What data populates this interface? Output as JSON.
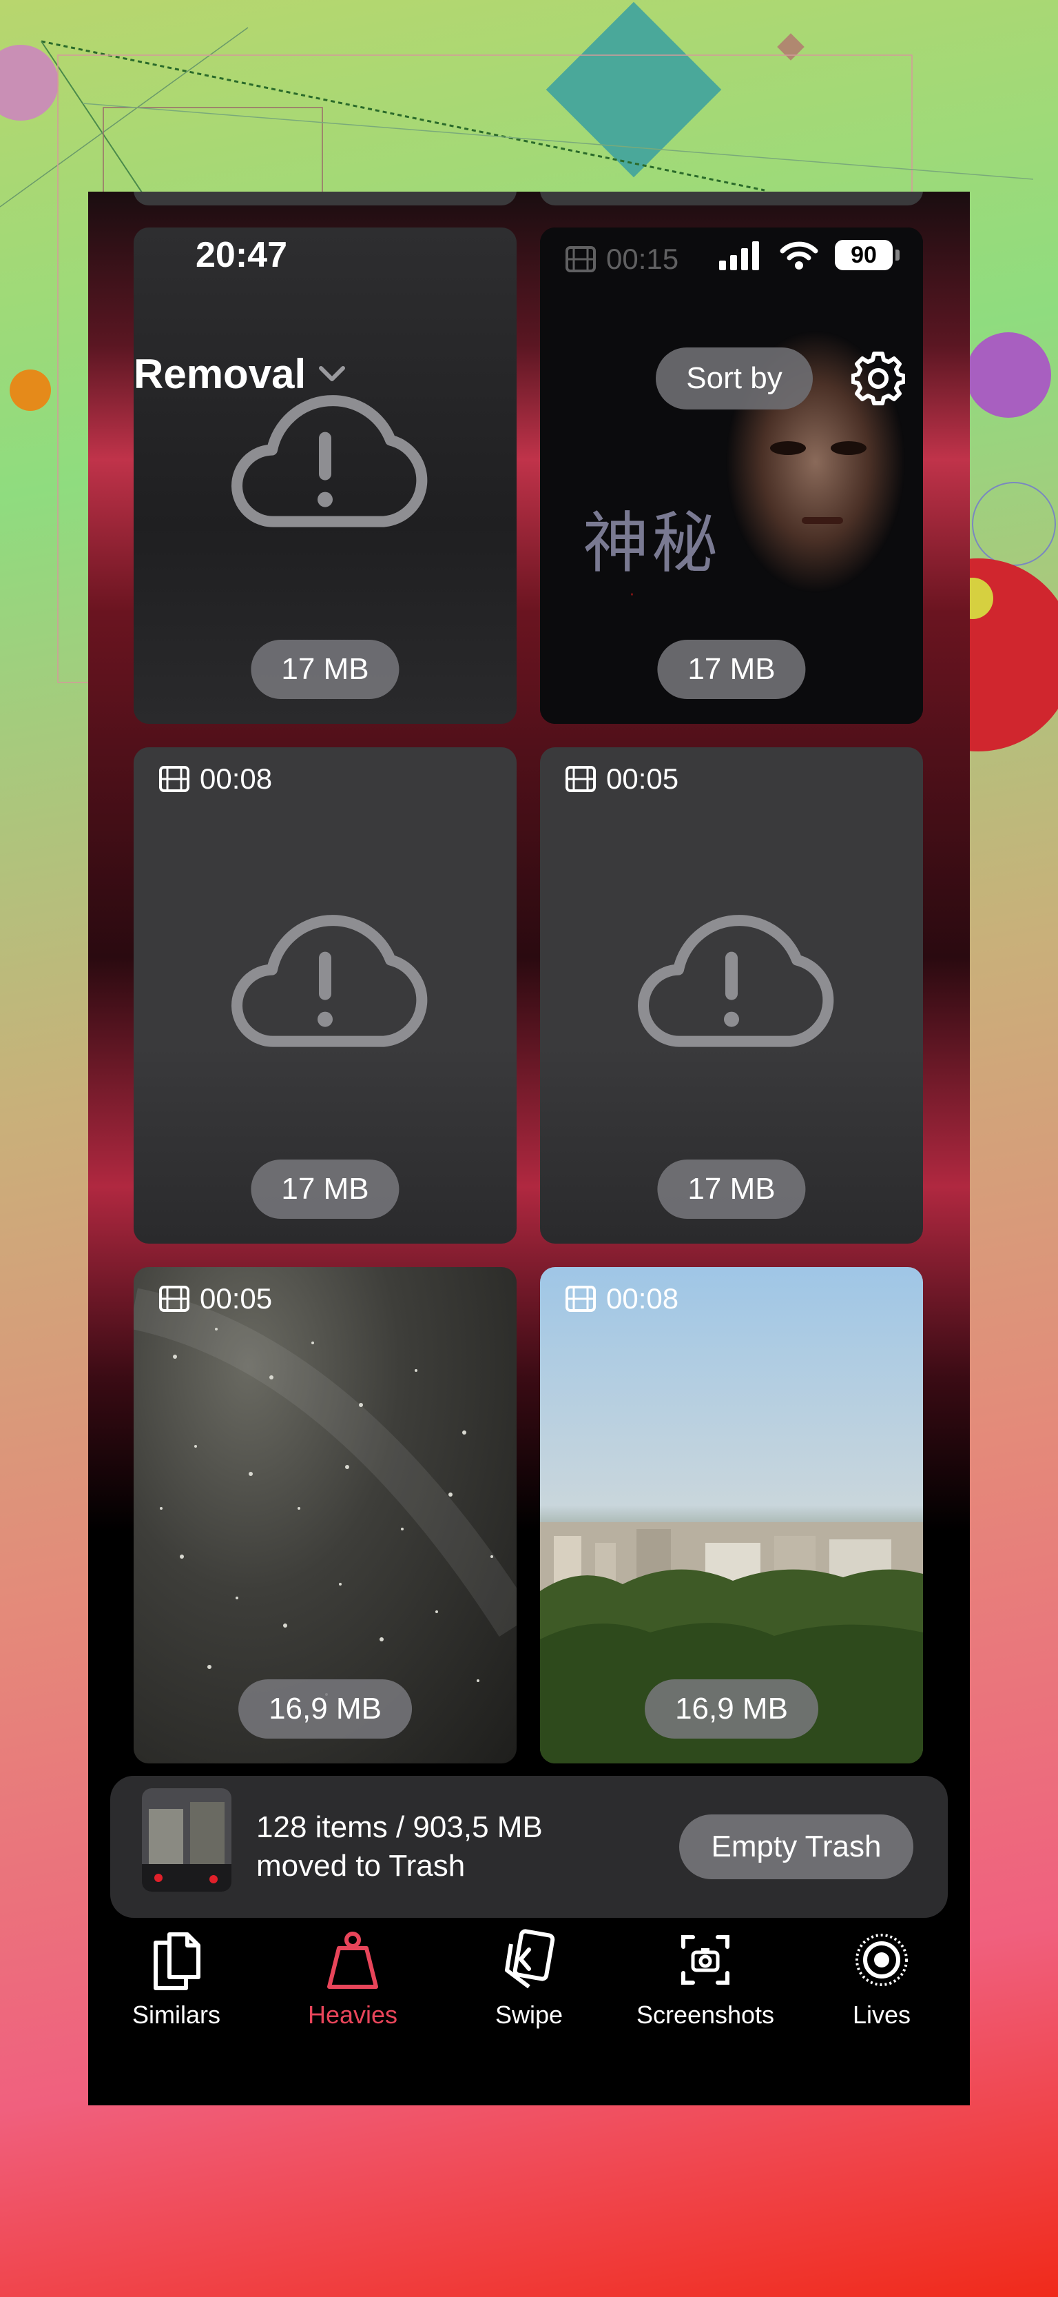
{
  "status_bar": {
    "time": "20:47",
    "battery": "90"
  },
  "header": {
    "title": "Removal",
    "sort_label": "Sort by"
  },
  "cards": [
    {
      "size": "17 MB",
      "duration": "",
      "state": "cloud-error"
    },
    {
      "size": "17 MB",
      "duration": "00:15",
      "state": "image",
      "overlay_text": "神秘"
    },
    {
      "size": "17 MB",
      "duration": "00:08",
      "state": "cloud-error"
    },
    {
      "size": "17 MB",
      "duration": "00:05",
      "state": "cloud-error"
    },
    {
      "size": "16,9 MB",
      "duration": "00:05",
      "state": "image"
    },
    {
      "size": "16,9 MB",
      "duration": "00:08",
      "state": "image"
    }
  ],
  "trash": {
    "line1": "128 items / 903,5 MB",
    "line2": "moved to Trash",
    "button": "Empty Trash"
  },
  "tabs": [
    {
      "label": "Similars",
      "icon": "similars-icon",
      "active": false
    },
    {
      "label": "Heavies",
      "icon": "heavies-icon",
      "active": true
    },
    {
      "label": "Swipe",
      "icon": "swipe-icon",
      "active": false
    },
    {
      "label": "Screenshots",
      "icon": "screenshots-icon",
      "active": false
    },
    {
      "label": "Lives",
      "icon": "lives-icon",
      "active": false
    }
  ],
  "colors": {
    "accent": "#e8455a",
    "card": "#3a3a3c",
    "badge": "#78787c"
  }
}
